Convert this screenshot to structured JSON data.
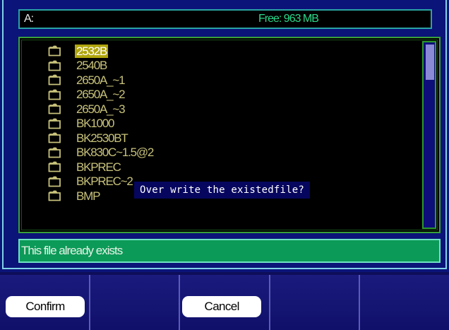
{
  "header": {
    "drive": "A:",
    "free_space": "Free: 963 MB"
  },
  "file_list": {
    "items": [
      {
        "name": "2532B",
        "icon": "folder-icon",
        "selected": true
      },
      {
        "name": "2540B",
        "icon": "folder-icon",
        "selected": false
      },
      {
        "name": "2650A_~1",
        "icon": "folder-icon",
        "selected": false
      },
      {
        "name": "2650A_~2",
        "icon": "folder-icon",
        "selected": false
      },
      {
        "name": "2650A_~3",
        "icon": "folder-icon",
        "selected": false
      },
      {
        "name": "BK1000",
        "icon": "folder-icon",
        "selected": false
      },
      {
        "name": "BK2530BT",
        "icon": "folder-icon",
        "selected": false
      },
      {
        "name": "BK830C~1.5@2",
        "icon": "folder-icon",
        "selected": false
      },
      {
        "name": "BKPREC",
        "icon": "folder-icon",
        "selected": false
      },
      {
        "name": "BKPREC~2",
        "icon": "folder-icon",
        "selected": false
      },
      {
        "name": "BMP",
        "icon": "folder-icon",
        "selected": false
      }
    ]
  },
  "dialog": {
    "message": "Over write the existedfile?"
  },
  "status": {
    "message": "This file already exists"
  },
  "softkeys": {
    "confirm_label": "Confirm",
    "cancel_label": "Cancel"
  },
  "colors": {
    "background": "#0b1478",
    "list_text": "#c8c27a",
    "selection": "#b0a60d",
    "free_space_text": "#29d98a",
    "status_bar": "#0c9a58"
  }
}
